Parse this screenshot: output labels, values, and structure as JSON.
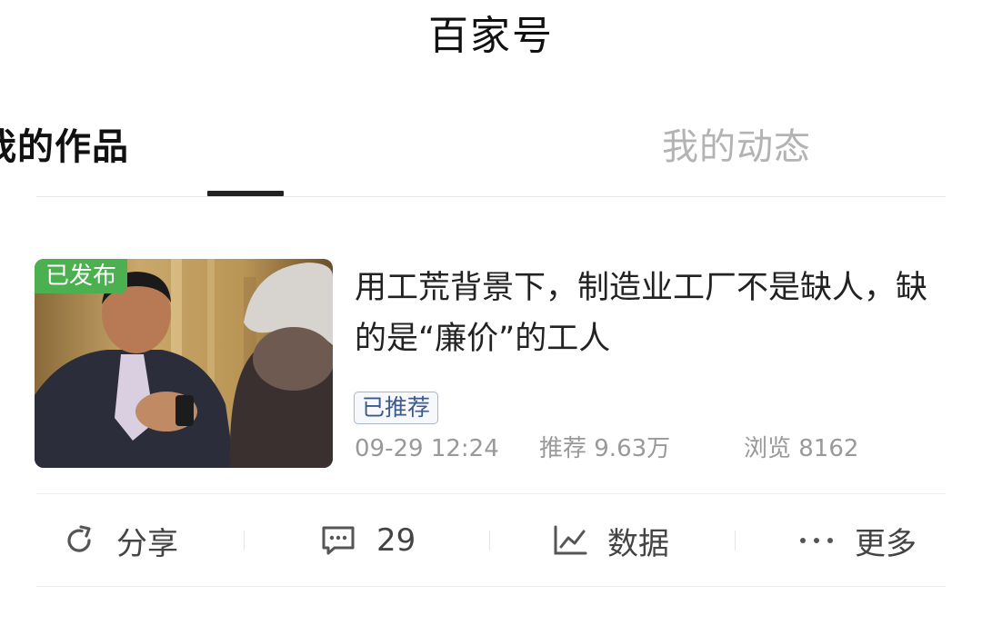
{
  "header": {
    "title": "百家号"
  },
  "tabs": [
    {
      "label": "我的作品",
      "active": true
    },
    {
      "label": "我的动态",
      "active": false
    }
  ],
  "article": {
    "status_tag": "已发布",
    "title": "用工荒背景下，制造业工厂不是缺人，缺的是“廉价”的工人",
    "badge": "已推荐",
    "time": "09-29 12:24",
    "recommend": "推荐 9.63万",
    "views": "浏览 8162"
  },
  "actions": {
    "share_label": "分享",
    "comments_count": "29",
    "data_label": "数据",
    "more_label": "更多"
  },
  "colors": {
    "status_tag_bg": "#4caf50",
    "badge_border": "#a9b6cf",
    "tab_active": "#111111",
    "tab_inactive": "#b3b3b3"
  },
  "icons": [
    "share-icon",
    "comment-icon",
    "chart-icon",
    "more-dots-icon"
  ]
}
